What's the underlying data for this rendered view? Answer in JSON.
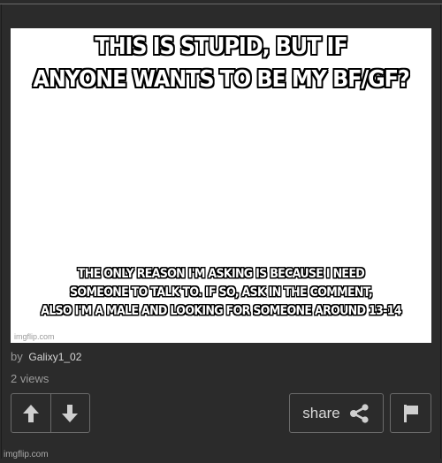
{
  "meme": {
    "top_lines": [
      "THIS IS STUPID, BUT IF",
      "ANYONE WANTS TO BE MY BF/GF?"
    ],
    "bottom_lines": [
      "THE ONLY REASON I'M ASKING IS BECAUSE I NEED",
      "SOMEONE TO TALK TO. IF SO, ASK IN THE COMMENT,",
      "ALSO I'M A MALE AND LOOKING FOR SOMEONE AROUND 13-14"
    ],
    "watermark": "imgflip.com"
  },
  "meta": {
    "by_label": "by",
    "author": "Galixy1_02",
    "views": "2 views"
  },
  "actions": {
    "upvote_icon": "arrow-up-icon",
    "downvote_icon": "arrow-down-icon",
    "share_label": "share",
    "share_icon": "share-icon",
    "flag_icon": "flag-icon"
  },
  "footer": {
    "watermark": "imgflip.com"
  },
  "colors": {
    "background": "#2b2b2b",
    "button_border": "#6a6a6a",
    "icon": "#cfcfcf",
    "muted_text": "#9a9a9a"
  }
}
